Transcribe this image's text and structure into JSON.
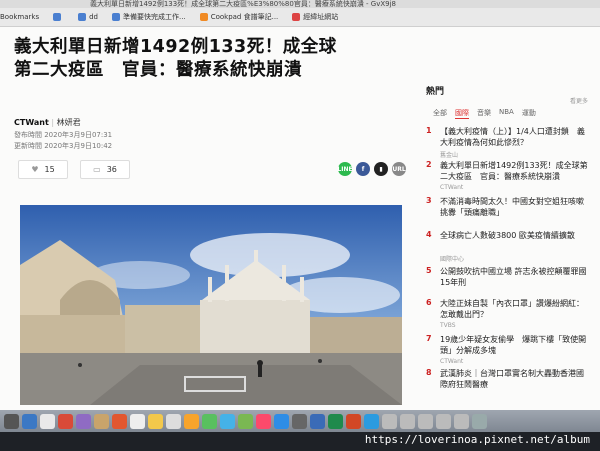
{
  "browser": {
    "url": "義大利單日新增1492例133死！成全球第二大疫區%E3%80%80官員：醫療系統快崩潰 - GvX9j8",
    "bookmarks": [
      "Bookmarks",
      "dd",
      "準備要快完成工作...",
      "Cookpad 食譜筆記...",
      "經緯址網站"
    ]
  },
  "article": {
    "title_line1": "義大利單日新增1492例133死！成全球",
    "title_line2": "第二大疫區　官員：醫療系統快崩潰",
    "source": "CTWant",
    "author": "林妍君",
    "published": "發布時間 2020年3月9日07:31",
    "updated": "更新時間 2020年3月9日10:42",
    "likes": "15",
    "comments": "36",
    "share": {
      "line": "LINE",
      "facebook": "f",
      "url": "URL"
    }
  },
  "sidebar": {
    "heading": "熱門",
    "more": "看更多",
    "tabs": [
      "全部",
      "國際",
      "音樂",
      "NBA",
      "運動"
    ],
    "items": [
      {
        "num": "1",
        "title": "【義大利疫情（上）】1/4人口遭封鎖　義大利疫情為何如此慘烈？",
        "source": "舊金山"
      },
      {
        "num": "2",
        "title": "義大利單日新增1492例133死！成全球第二大疫區　官員：醫療系統快崩潰",
        "source": "CTWant"
      },
      {
        "num": "3",
        "title": "不滿消毒時間太久！中國女對空姐狂咳嗽挑釁「頭痛離職」"
      },
      {
        "num": "4",
        "title": "全球病亡人數破3800 歐美疫情續擴散",
        "source": "國際中心"
      },
      {
        "num": "5",
        "title": "公開鼓吹抗中國立場 許志永被控顛覆罪國15年刑"
      },
      {
        "num": "6",
        "title": "大陸正妹自製「內衣口罩」讚爆紛網紅：怎敢戴出門？",
        "source": "TVBS"
      },
      {
        "num": "7",
        "title": "19歲少年疑女友偷學　爆跳下樓「致使開頭」分解成多塊",
        "source": "CTWant"
      },
      {
        "num": "8",
        "title": "武漢肺炎｜台灣口罩實名制大轟動香港國際府狂鬧醫療"
      }
    ]
  },
  "watermark": "https://loverinoa.pixnet.net/album"
}
